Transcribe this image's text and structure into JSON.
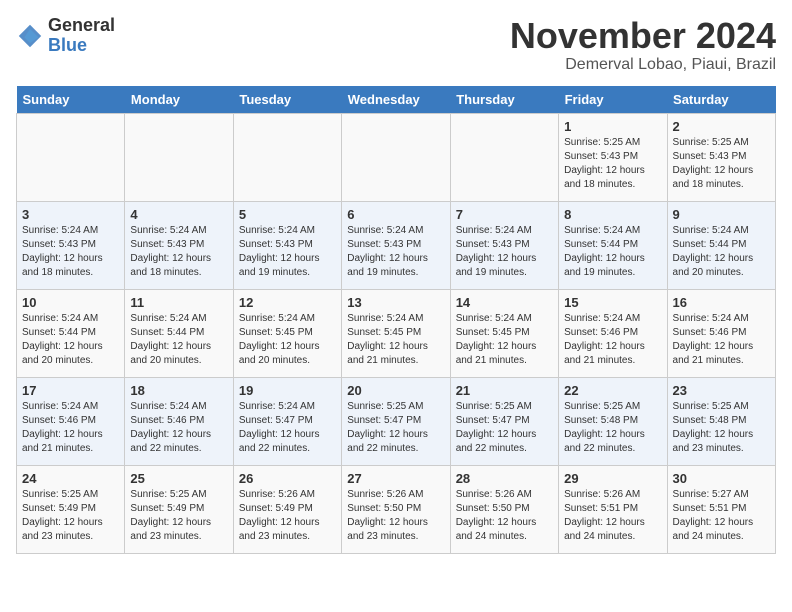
{
  "header": {
    "logo_general": "General",
    "logo_blue": "Blue",
    "month_year": "November 2024",
    "location": "Demerval Lobao, Piaui, Brazil"
  },
  "days_of_week": [
    "Sunday",
    "Monday",
    "Tuesday",
    "Wednesday",
    "Thursday",
    "Friday",
    "Saturday"
  ],
  "weeks": [
    [
      {
        "day": "",
        "info": ""
      },
      {
        "day": "",
        "info": ""
      },
      {
        "day": "",
        "info": ""
      },
      {
        "day": "",
        "info": ""
      },
      {
        "day": "",
        "info": ""
      },
      {
        "day": "1",
        "info": "Sunrise: 5:25 AM\nSunset: 5:43 PM\nDaylight: 12 hours and 18 minutes."
      },
      {
        "day": "2",
        "info": "Sunrise: 5:25 AM\nSunset: 5:43 PM\nDaylight: 12 hours and 18 minutes."
      }
    ],
    [
      {
        "day": "3",
        "info": "Sunrise: 5:24 AM\nSunset: 5:43 PM\nDaylight: 12 hours and 18 minutes."
      },
      {
        "day": "4",
        "info": "Sunrise: 5:24 AM\nSunset: 5:43 PM\nDaylight: 12 hours and 18 minutes."
      },
      {
        "day": "5",
        "info": "Sunrise: 5:24 AM\nSunset: 5:43 PM\nDaylight: 12 hours and 19 minutes."
      },
      {
        "day": "6",
        "info": "Sunrise: 5:24 AM\nSunset: 5:43 PM\nDaylight: 12 hours and 19 minutes."
      },
      {
        "day": "7",
        "info": "Sunrise: 5:24 AM\nSunset: 5:43 PM\nDaylight: 12 hours and 19 minutes."
      },
      {
        "day": "8",
        "info": "Sunrise: 5:24 AM\nSunset: 5:44 PM\nDaylight: 12 hours and 19 minutes."
      },
      {
        "day": "9",
        "info": "Sunrise: 5:24 AM\nSunset: 5:44 PM\nDaylight: 12 hours and 20 minutes."
      }
    ],
    [
      {
        "day": "10",
        "info": "Sunrise: 5:24 AM\nSunset: 5:44 PM\nDaylight: 12 hours and 20 minutes."
      },
      {
        "day": "11",
        "info": "Sunrise: 5:24 AM\nSunset: 5:44 PM\nDaylight: 12 hours and 20 minutes."
      },
      {
        "day": "12",
        "info": "Sunrise: 5:24 AM\nSunset: 5:45 PM\nDaylight: 12 hours and 20 minutes."
      },
      {
        "day": "13",
        "info": "Sunrise: 5:24 AM\nSunset: 5:45 PM\nDaylight: 12 hours and 21 minutes."
      },
      {
        "day": "14",
        "info": "Sunrise: 5:24 AM\nSunset: 5:45 PM\nDaylight: 12 hours and 21 minutes."
      },
      {
        "day": "15",
        "info": "Sunrise: 5:24 AM\nSunset: 5:46 PM\nDaylight: 12 hours and 21 minutes."
      },
      {
        "day": "16",
        "info": "Sunrise: 5:24 AM\nSunset: 5:46 PM\nDaylight: 12 hours and 21 minutes."
      }
    ],
    [
      {
        "day": "17",
        "info": "Sunrise: 5:24 AM\nSunset: 5:46 PM\nDaylight: 12 hours and 21 minutes."
      },
      {
        "day": "18",
        "info": "Sunrise: 5:24 AM\nSunset: 5:46 PM\nDaylight: 12 hours and 22 minutes."
      },
      {
        "day": "19",
        "info": "Sunrise: 5:24 AM\nSunset: 5:47 PM\nDaylight: 12 hours and 22 minutes."
      },
      {
        "day": "20",
        "info": "Sunrise: 5:25 AM\nSunset: 5:47 PM\nDaylight: 12 hours and 22 minutes."
      },
      {
        "day": "21",
        "info": "Sunrise: 5:25 AM\nSunset: 5:47 PM\nDaylight: 12 hours and 22 minutes."
      },
      {
        "day": "22",
        "info": "Sunrise: 5:25 AM\nSunset: 5:48 PM\nDaylight: 12 hours and 22 minutes."
      },
      {
        "day": "23",
        "info": "Sunrise: 5:25 AM\nSunset: 5:48 PM\nDaylight: 12 hours and 23 minutes."
      }
    ],
    [
      {
        "day": "24",
        "info": "Sunrise: 5:25 AM\nSunset: 5:49 PM\nDaylight: 12 hours and 23 minutes."
      },
      {
        "day": "25",
        "info": "Sunrise: 5:25 AM\nSunset: 5:49 PM\nDaylight: 12 hours and 23 minutes."
      },
      {
        "day": "26",
        "info": "Sunrise: 5:26 AM\nSunset: 5:49 PM\nDaylight: 12 hours and 23 minutes."
      },
      {
        "day": "27",
        "info": "Sunrise: 5:26 AM\nSunset: 5:50 PM\nDaylight: 12 hours and 23 minutes."
      },
      {
        "day": "28",
        "info": "Sunrise: 5:26 AM\nSunset: 5:50 PM\nDaylight: 12 hours and 24 minutes."
      },
      {
        "day": "29",
        "info": "Sunrise: 5:26 AM\nSunset: 5:51 PM\nDaylight: 12 hours and 24 minutes."
      },
      {
        "day": "30",
        "info": "Sunrise: 5:27 AM\nSunset: 5:51 PM\nDaylight: 12 hours and 24 minutes."
      }
    ]
  ]
}
